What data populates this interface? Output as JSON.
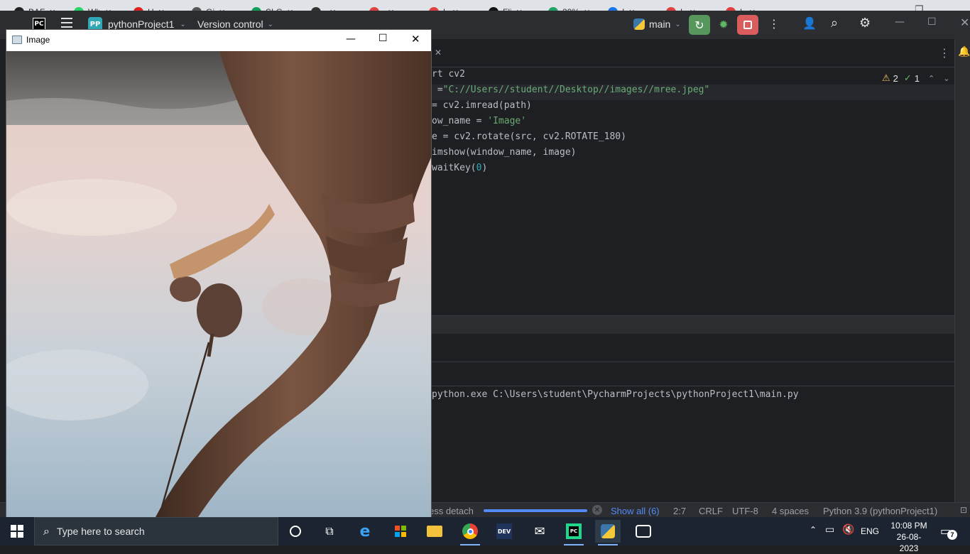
{
  "browser_tabs": [
    {
      "label": "BAF",
      "color": "#222222"
    },
    {
      "label": "Wh",
      "color": "#25d366"
    },
    {
      "label": "H",
      "color": "#e02020"
    },
    {
      "label": "Gi",
      "color": "#555555"
    },
    {
      "label": "SLG",
      "color": "#0f9d58"
    },
    {
      "label": "",
      "color": "#333333"
    },
    {
      "label": "",
      "color": "#e04040"
    },
    {
      "label": "L",
      "color": "#e04040"
    },
    {
      "label": "Fli",
      "color": "#111111"
    },
    {
      "label": "20%",
      "color": "#21a366"
    },
    {
      "label": "I",
      "color": "#1a73e8"
    },
    {
      "label": "L",
      "color": "#e04040"
    },
    {
      "label": "L",
      "color": "#e04040"
    }
  ],
  "ide": {
    "logo": "PC",
    "project_badge": "PP",
    "project_name": "pythonProject1",
    "vcs_menu": "Version control",
    "branch": "main",
    "warning_count": "2",
    "check_count": "1",
    "code": [
      {
        "pre": "rt cv2",
        "str": "",
        "post": ""
      },
      {
        "pre": " =",
        "str": "\"C://Users//student//Desktop//images//mree.jpeg\"",
        "post": ""
      },
      {
        "pre": "= cv2.imread(path)",
        "str": "",
        "post": ""
      },
      {
        "pre": "ow_name = ",
        "str": "'Image'",
        "post": ""
      },
      {
        "pre": "e = cv2.rotate(src, cv2.ROTATE_180)",
        "str": "",
        "post": ""
      },
      {
        "pre": "imshow(window_name, image)",
        "str": "",
        "post": ""
      },
      {
        "pre": "waitKey(",
        "num": "0",
        "post": ")"
      }
    ],
    "console_line": "python.exe C:\\Users\\student\\PycharmProjects\\pythonProject1\\main.py",
    "status": {
      "process": "ess detach",
      "show_all": "Show all (6)",
      "position": "2:7",
      "line_sep": "CRLF",
      "encoding": "UTF-8",
      "indent": "4 spaces",
      "interpreter": "Python 3.9 (pythonProject1)",
      "progress": 1.0
    }
  },
  "image_window": {
    "title": "Image"
  },
  "taskbar": {
    "search_placeholder": "Type here to search",
    "language": "ENG",
    "time": "10:08 PM",
    "date": "26-08-2023",
    "notification_count": "7"
  }
}
